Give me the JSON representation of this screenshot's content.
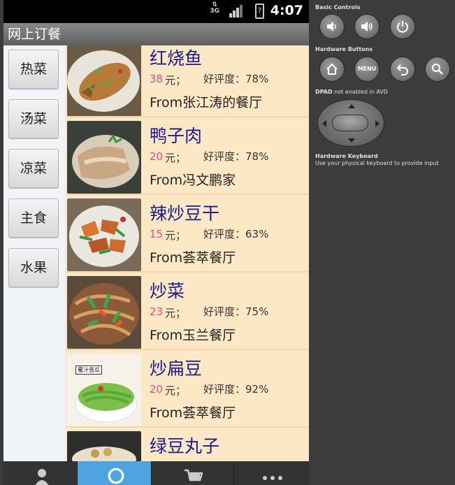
{
  "status_bar": {
    "network_label": "3G",
    "time": "4:07",
    "battery_glyph": "?"
  },
  "app": {
    "title": "网上订餐"
  },
  "categories": [
    "热菜",
    "汤菜",
    "凉菜",
    "主食",
    "水果"
  ],
  "dishes": [
    {
      "name": "红烧鱼",
      "price": "38",
      "unit": "元；",
      "rating": "好评度：78%",
      "source": "From张江涛的餐厅",
      "image": "braised-fish-image"
    },
    {
      "name": "鸭子肉",
      "price": "20",
      "unit": "元；",
      "rating": "好评度：78%",
      "source": "From冯文鹏家",
      "image": "duck-meat-image"
    },
    {
      "name": "辣炒豆干",
      "price": "15",
      "unit": "元；",
      "rating": "好评度：63%",
      "source": "From荟萃餐厅",
      "image": "spicy-tofu-image"
    },
    {
      "name": "炒菜",
      "price": "23",
      "unit": "元；",
      "rating": "好评度：75%",
      "source": "From玉兰餐厅",
      "image": "stir-fry-image"
    },
    {
      "name": "炒扁豆",
      "price": "20",
      "unit": "元；",
      "rating": "好评度：92%",
      "source": "From荟萃餐厅",
      "image": "green-beans-image",
      "image_label": "蜜汁苦瓜"
    },
    {
      "name": "绿豆丸子",
      "price": "",
      "unit": "",
      "rating": "",
      "source": "",
      "image": "mung-bean-balls-image"
    }
  ],
  "bottom_tabs": [
    {
      "icon": "user-icon",
      "active": false
    },
    {
      "icon": "search-icon",
      "active": true
    },
    {
      "icon": "cart-icon",
      "active": false
    },
    {
      "icon": "more-icon",
      "active": false
    }
  ],
  "emulator_panel": {
    "basic_controls_title": "Basic Controls",
    "hardware_buttons_title": "Hardware Buttons",
    "menu_label": "MENU",
    "dpad_title_bold": "DPAD",
    "dpad_title_rest": " not enabled in AVD",
    "keyboard_title": "Hardware Keyboard",
    "keyboard_hint": "Use your physical keyboard to provide input"
  }
}
